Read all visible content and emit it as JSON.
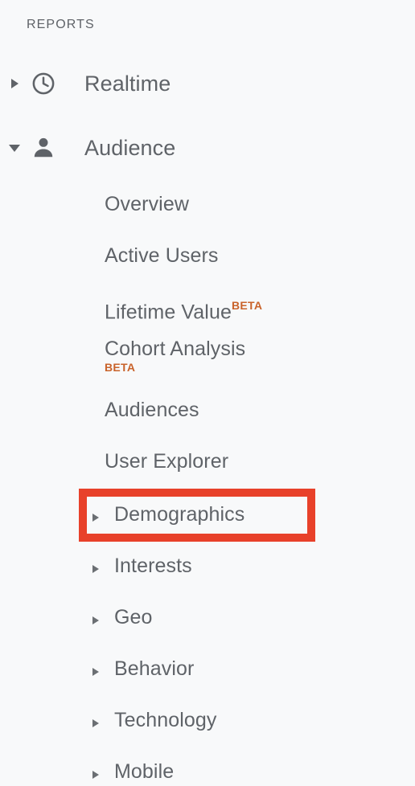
{
  "sidebar": {
    "section_header": "REPORTS",
    "background_color": "#f8f9fa",
    "text_color": "#5f6368",
    "beta_color": "#c9632b",
    "highlight_color": "#e8412a",
    "top_items": [
      {
        "id": "realtime",
        "label": "Realtime",
        "icon": "clock-icon",
        "expanded": false,
        "arrow": "triangle-right"
      },
      {
        "id": "audience",
        "label": "Audience",
        "icon": "person-icon",
        "expanded": true,
        "arrow": "triangle-down"
      }
    ],
    "sub_items": [
      {
        "id": "overview",
        "label": "Overview",
        "badge": "",
        "badge_position": "none",
        "expandable": false,
        "highlighted": false
      },
      {
        "id": "active-users",
        "label": "Active Users",
        "badge": "",
        "badge_position": "none",
        "expandable": false,
        "highlighted": false
      },
      {
        "id": "lifetime-value",
        "label": "Lifetime Value",
        "badge": "BETA",
        "badge_position": "superscript",
        "expandable": false,
        "highlighted": false
      },
      {
        "id": "cohort-analysis",
        "label": "Cohort Analysis",
        "badge": "BETA",
        "badge_position": "below",
        "expandable": false,
        "highlighted": false
      },
      {
        "id": "audiences",
        "label": "Audiences",
        "badge": "",
        "badge_position": "none",
        "expandable": false,
        "highlighted": false
      },
      {
        "id": "user-explorer",
        "label": "User Explorer",
        "badge": "",
        "badge_position": "none",
        "expandable": false,
        "highlighted": false
      },
      {
        "id": "demographics",
        "label": "Demographics",
        "badge": "",
        "badge_position": "none",
        "expandable": true,
        "highlighted": true
      },
      {
        "id": "interests",
        "label": "Interests",
        "badge": "",
        "badge_position": "none",
        "expandable": true,
        "highlighted": false
      },
      {
        "id": "geo",
        "label": "Geo",
        "badge": "",
        "badge_position": "none",
        "expandable": true,
        "highlighted": false
      },
      {
        "id": "behavior",
        "label": "Behavior",
        "badge": "",
        "badge_position": "none",
        "expandable": true,
        "highlighted": false
      },
      {
        "id": "technology",
        "label": "Technology",
        "badge": "",
        "badge_position": "none",
        "expandable": true,
        "highlighted": false
      },
      {
        "id": "mobile",
        "label": "Mobile",
        "badge": "",
        "badge_position": "none",
        "expandable": true,
        "highlighted": false
      }
    ]
  }
}
